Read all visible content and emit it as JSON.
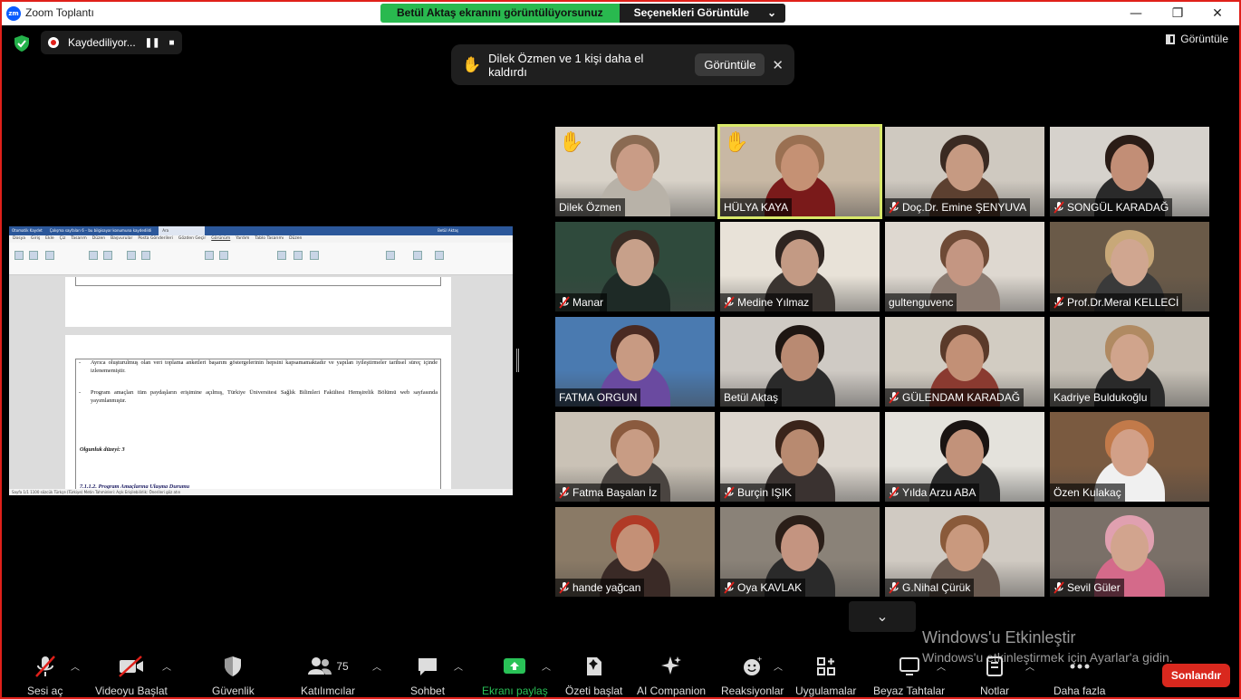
{
  "window": {
    "title": "Zoom Toplantı",
    "logo_text": "zm",
    "controls": [
      "—",
      "❐",
      "✕"
    ]
  },
  "share_banner": {
    "text": "Betül Aktaş ekranını görüntülüyorsunuz",
    "options_label": "Seçenekleri Görüntüle",
    "options_caret": "⌄"
  },
  "recording": {
    "label": "Kaydediliyor...",
    "pause": "❚❚",
    "stop": "■"
  },
  "view_button": {
    "label": "Görüntüle"
  },
  "hand_toast": {
    "icon": "✋",
    "message": "Dilek Özmen ve 1 kişi daha el kaldırdı",
    "action": "Görüntüle",
    "close": "✕"
  },
  "shared_doc": {
    "title_bar": [
      "Otomatik Kaydet",
      "Çalışma sayfaları 6 – bu bilgisayar konumuna kaydedildi",
      "Ara",
      "Betül Aktaş"
    ],
    "tabs": [
      "Dosya",
      "Giriş",
      "Ekle",
      "Çiz",
      "Tasarım",
      "Düzen",
      "Başvurular",
      "Posta Gönderileri",
      "Gözden Geçir",
      "Görünüm",
      "Yardım",
      "Tablo Tasarımı",
      "Düzen"
    ],
    "bullet1": "Ayrıca oluşturulmuş olan veri toplama anketleri başarım göstergelerinin hepsini kapsamamaktadır ve yapılan iyileştirmeler tarihsel süreç içinde izlenememiştir.",
    "bullet2": "Program amaçları tüm paydaşların erişimine açılmış, Türkiye Üniversitesi Sağlık Bilimleri Fakültesi Hemşirelik Bölümü web sayfasında yayımlanmıştır.",
    "maturity": "Olgunluk düzeyi: 3",
    "section": "7.1.1.2. Program Amaçlarına Ulaşma Durumu",
    "status": "Sayfa 1/1   1100 sözcük   Türkçe (Türkiye)   Metin Tahminleri: Açık   Erişilebilirlik: Önerileri göz atın"
  },
  "participants": [
    {
      "name": "Dilek Özmen",
      "muted": false,
      "hand": true,
      "bg": "#d8d2c8",
      "skin": "#c99c86",
      "hair": "#8a6a52",
      "shirt": "#b8b2a8"
    },
    {
      "name": "HÜLYA KAYA",
      "muted": false,
      "hand": true,
      "active": true,
      "bg": "#c8b8a4",
      "skin": "#c59174",
      "hair": "#9a7052",
      "shirt": "#7a1a1a"
    },
    {
      "name": "Doç.Dr. Emine ŞENYUVA",
      "muted": true,
      "bg": "#cfc9c0",
      "skin": "#c69a82",
      "hair": "#3a2a22",
      "shirt": "#5c4030"
    },
    {
      "name": "SONGÜL KARADAĞ",
      "muted": true,
      "bg": "#d6d2cc",
      "skin": "#c28e76",
      "hair": "#2a1c16",
      "shirt": "#2a2a2a"
    },
    {
      "name": "Manar",
      "muted": true,
      "bg": "#2f4a3c",
      "skin": "#c7a08a",
      "hair": "#3a2c24",
      "shirt": "#1e2a26"
    },
    {
      "name": "Medine Yılmaz",
      "muted": true,
      "bg": "#e8e2d8",
      "skin": "#c39a84",
      "hair": "#2e2420",
      "shirt": "#3a3430"
    },
    {
      "name": "gultenguvenc",
      "muted": false,
      "bg": "#ded8d0",
      "skin": "#c49682",
      "hair": "#6e4a36",
      "shirt": "#8a7a70"
    },
    {
      "name": "Prof.Dr.Meral KELLECİ",
      "muted": true,
      "bg": "#6a5a48",
      "skin": "#d0a690",
      "hair": "#c8a878",
      "shirt": "#3a3a3a"
    },
    {
      "name": "FATMA ORGUN",
      "muted": false,
      "bg": "#4a7ab0",
      "skin": "#c89a82",
      "hair": "#4a2a22",
      "shirt": "#6a4aa0"
    },
    {
      "name": "Betül Aktaş",
      "muted": false,
      "bg": "#cfcac4",
      "skin": "#b98a72",
      "hair": "#1e1612",
      "shirt": "#2a2a2a"
    },
    {
      "name": "GÜLENDAM KARADAĞ",
      "muted": true,
      "bg": "#d2ccc2",
      "skin": "#c29076",
      "hair": "#5a3a2a",
      "shirt": "#8a3a30"
    },
    {
      "name": "Kadriye Buldukoğlu",
      "muted": false,
      "bg": "#c6c0b6",
      "skin": "#d0a48c",
      "hair": "#b08a62",
      "shirt": "#2a2a2a"
    },
    {
      "name": "Fatma Başalan İz",
      "muted": true,
      "bg": "#cac2b6",
      "skin": "#c89c84",
      "hair": "#8a5a3e",
      "shirt": "#4a4440"
    },
    {
      "name": "Burçin IŞIK",
      "muted": true,
      "bg": "#dcd6ce",
      "skin": "#b88a70",
      "hair": "#3a241a",
      "shirt": "#3a3230"
    },
    {
      "name": "Yılda Arzu ABA",
      "muted": true,
      "bg": "#e4e2dc",
      "skin": "#c2927a",
      "hair": "#1a1412",
      "shirt": "#2a2a2a"
    },
    {
      "name": "Özen Kulakaç",
      "muted": false,
      "bg": "#7a5a40",
      "skin": "#d2a088",
      "hair": "#c27a4a",
      "shirt": "#f0f0f0"
    },
    {
      "name": "hande yağcan",
      "muted": true,
      "bg": "#8a7a66",
      "skin": "#c49076",
      "hair": "#b03a26",
      "shirt": "#3a2a26"
    },
    {
      "name": "Oya KAVLAK",
      "muted": true,
      "bg": "#8a8278",
      "skin": "#c49480",
      "hair": "#2a1e18",
      "shirt": "#2a2a2a"
    },
    {
      "name": "G.Nihal Çürük",
      "muted": true,
      "bg": "#d0cac2",
      "skin": "#c9997e",
      "hair": "#8a5a3a",
      "shirt": "#6a5a50"
    },
    {
      "name": "Sevil Güler",
      "muted": true,
      "bg": "#7a7068",
      "skin": "#d2a48e",
      "hair": "#e0a0b0",
      "shirt": "#d46a8a"
    }
  ],
  "grid_chevron": "⌄",
  "watermark": {
    "title": "Windows'u Etkinleştir",
    "subtitle": "Windows'u etkinleştirmek için Ayarlar'a gidin."
  },
  "toolbar": {
    "audio": "Sesi aç",
    "video": "Videoyu Başlat",
    "security": "Güvenlik",
    "participants": "Katılımcılar",
    "participants_count": "75",
    "chat": "Sohbet",
    "share": "Ekranı paylaş",
    "summary": "Özeti başlat",
    "ai": "AI Companion",
    "reactions": "Reaksiyonlar",
    "apps": "Uygulamalar",
    "whiteboards": "Beyaz Tahtalar",
    "notes": "Notlar",
    "more": "Daha fazla",
    "end": "Sonlandır"
  },
  "colors": {
    "end_red": "#d9281e",
    "share_green": "#29c257",
    "banner_green": "#29b94f",
    "active_speaker": "#d8e86a"
  }
}
